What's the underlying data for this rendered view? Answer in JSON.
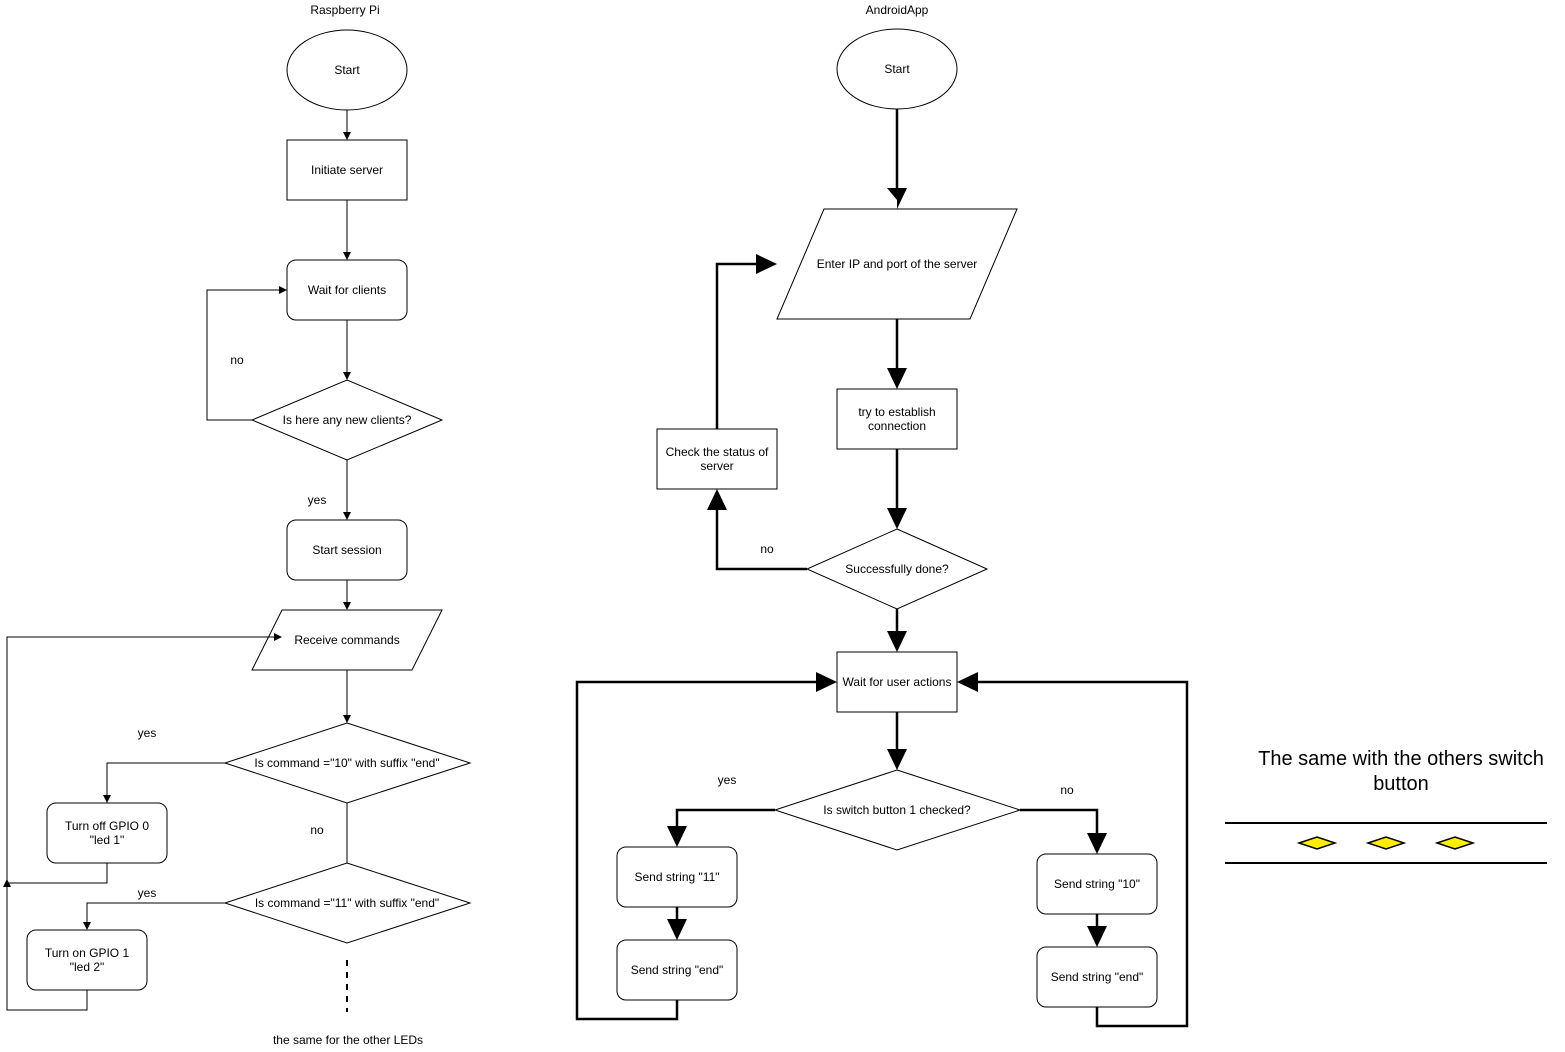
{
  "diagram": {
    "titles": {
      "raspberry": "Raspberry Pi",
      "android": "AndroidApp"
    },
    "raspberry_nodes": {
      "start": "Start",
      "initiate": "Initiate server",
      "wait_clients": "Wait for clients",
      "new_clients": "Is here any new clients?",
      "start_session": "Start session",
      "receive": "Receive commands",
      "cmd10": "Is command =\"10\" with suffix \"end\"",
      "turn_off_l1": "Turn off GPIO 0",
      "turn_off_l2": "\"led 1\"",
      "cmd11": "Is command =\"11\" with suffix \"end\"",
      "turn_on_l1": "Turn on GPIO 1",
      "turn_on_l2": "\"led 2\"",
      "other_leds": "the same for the other LEDs"
    },
    "raspberry_labels": {
      "no_clients": "no",
      "yes_clients": "yes",
      "yes_cmd10": "yes",
      "no_cmd10": "no",
      "yes_cmd11": "yes"
    },
    "android_nodes": {
      "start": "Start",
      "enter_ip": "Enter IP and port of the server",
      "try_l1": "try to establish",
      "try_l2": "connection",
      "check_l1": "Check the status of",
      "check_l2": "server",
      "success": "Successfully done?",
      "wait_user": "Wait for user actions",
      "switch": "Is switch button 1 checked?",
      "send11": "Send string \"11\"",
      "send_end_left": "Send string \"end\"",
      "send10": "Send string \"10\"",
      "send_end_right": "Send string \"end\""
    },
    "android_labels": {
      "no_success": "no",
      "yes_switch": "yes",
      "no_switch": "no"
    },
    "note": {
      "line1": "The same with the others switch",
      "line2": "button",
      "diamond_color": "#ffee00"
    }
  }
}
